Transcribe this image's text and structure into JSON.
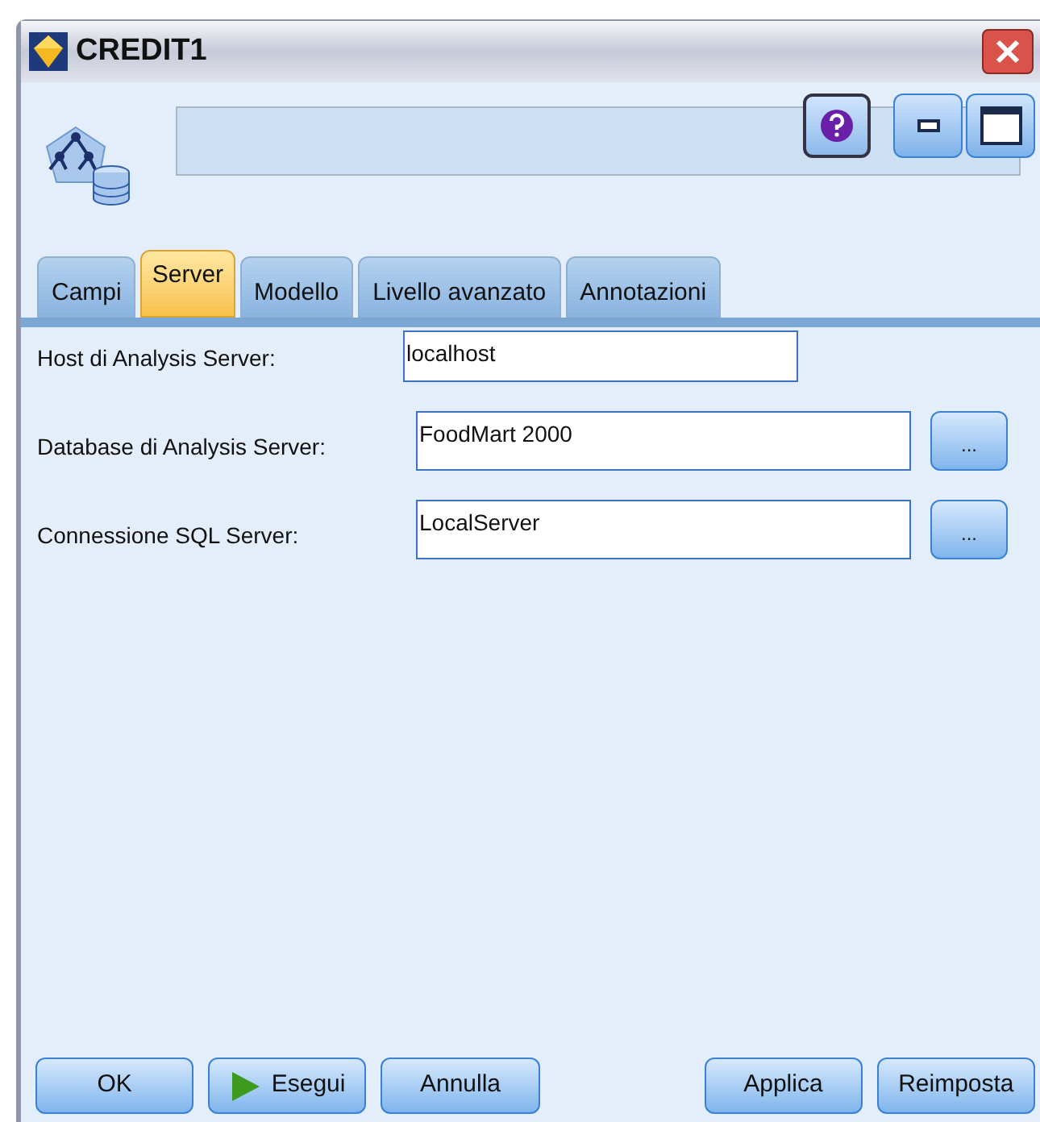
{
  "window": {
    "title": "CREDIT1"
  },
  "tabs": [
    {
      "label": "Campi",
      "selected": false
    },
    {
      "label": "Server",
      "selected": true
    },
    {
      "label": "Modello",
      "selected": false
    },
    {
      "label": "Livello avanzato",
      "selected": false
    },
    {
      "label": "Annotazioni",
      "selected": false
    }
  ],
  "fields": [
    {
      "label": "Host di Analysis Server:",
      "value": "localhost"
    },
    {
      "label": "Database di Analysis Server:",
      "value": "FoodMart 2000",
      "browse_label": "..."
    },
    {
      "label": "Connessione SQL Server:",
      "value": "LocalServer",
      "browse_label": "..."
    }
  ],
  "buttons": [
    {
      "label": "OK",
      "kind": "plain"
    },
    {
      "label": "Esegui",
      "kind": "run"
    },
    {
      "label": "Annulla",
      "kind": "plain"
    },
    {
      "label": "Applica",
      "kind": "plain"
    },
    {
      "label": "Reimposta",
      "kind": "plain"
    }
  ]
}
